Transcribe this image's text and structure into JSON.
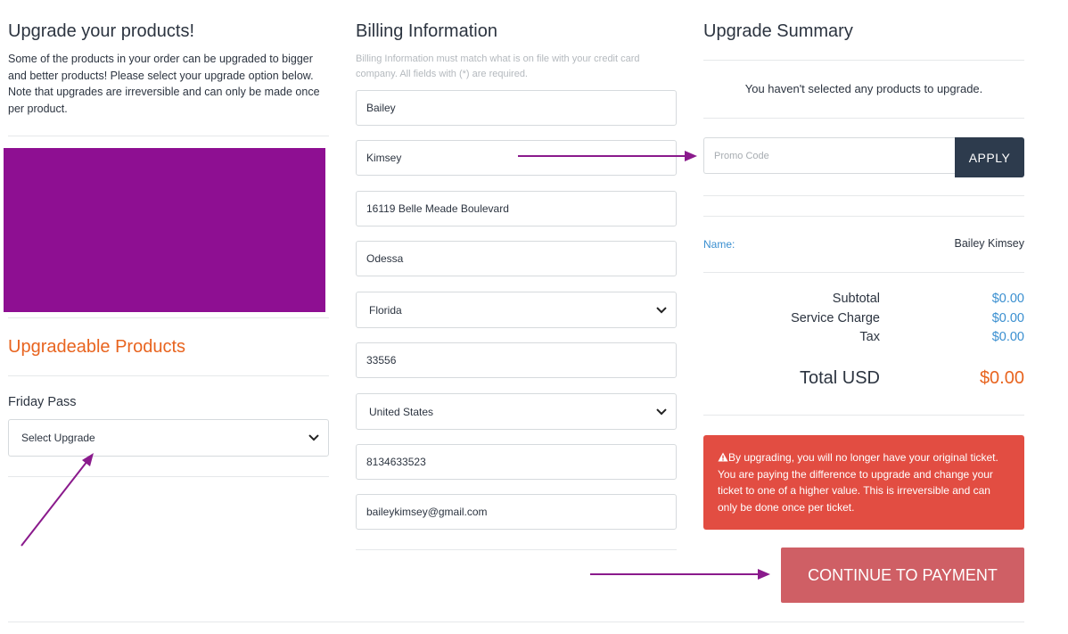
{
  "upgrade": {
    "title": "Upgrade your products!",
    "intro": "Some of the products in your order can be upgraded to bigger and better products! Please select your upgrade option below. Note that upgrades are irreversible and can only be made once per product.",
    "banner_color": "#8e0f92",
    "section_title": "Upgradeable Products",
    "product_label": "Friday Pass",
    "product_select": "Select Upgrade"
  },
  "billing": {
    "title": "Billing Information",
    "hint": "Billing Information must match what is on file with your credit card company. All fields with (*) are required.",
    "first_name": "Bailey",
    "last_name": "Kimsey",
    "address": "16119 Belle Meade Boulevard",
    "city": "Odessa",
    "state": "Florida",
    "zip": "33556",
    "country": "United States",
    "phone": "8134633523",
    "email": "baileykimsey@gmail.com"
  },
  "summary": {
    "title": "Upgrade Summary",
    "empty_message": "You haven't selected any products to upgrade.",
    "promo_placeholder": "Promo Code",
    "apply_label": "APPLY",
    "name_label": "Name:",
    "name_value": "Bailey Kimsey",
    "subtotal_label": "Subtotal",
    "subtotal_value": "$0.00",
    "service_label": "Service Charge",
    "service_value": "$0.00",
    "tax_label": "Tax",
    "tax_value": "$0.00",
    "total_label": "Total USD",
    "total_value": "$0.00",
    "warning_icon": "warning-triangle-icon",
    "warning_text": "By upgrading, you will no longer have your original ticket. You are paying the difference to upgrade and change your ticket to one of a higher value. This is irreversible and can only be done once per ticket.",
    "continue_label": "CONTINUE TO PAYMENT"
  },
  "colors": {
    "accent_orange": "#e8641f",
    "dark_navy": "#2d3b4d",
    "warning_red": "#e24d42",
    "cta_red": "#cf5f65",
    "link_blue": "#3a8fd0",
    "annotation_purple": "#8a1a8c"
  }
}
